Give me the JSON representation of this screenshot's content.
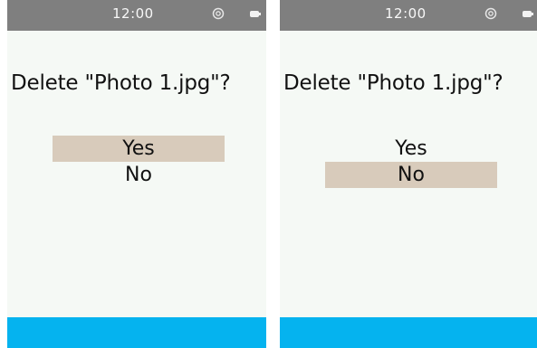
{
  "screens": [
    {
      "status": {
        "time": "12:00",
        "signal_icon": "signal-icon",
        "battery_icon": "battery-icon"
      },
      "dialog": {
        "prompt": "Delete \"Photo 1.jpg\"?",
        "options": [
          {
            "label": "Yes",
            "selected": true
          },
          {
            "label": "No",
            "selected": false
          }
        ]
      }
    },
    {
      "status": {
        "time": "12:00",
        "signal_icon": "signal-icon",
        "battery_icon": "battery-icon"
      },
      "dialog": {
        "prompt": "Delete \"Photo 1.jpg\"?",
        "options": [
          {
            "label": "Yes",
            "selected": false
          },
          {
            "label": "No",
            "selected": true
          }
        ]
      }
    }
  ],
  "colors": {
    "status_bar": "#7f7f7f",
    "screen_background": "#f5f9f5",
    "highlight": "#d8cbbb",
    "bottom_bar": "#05b3ef",
    "text": "#111111"
  }
}
